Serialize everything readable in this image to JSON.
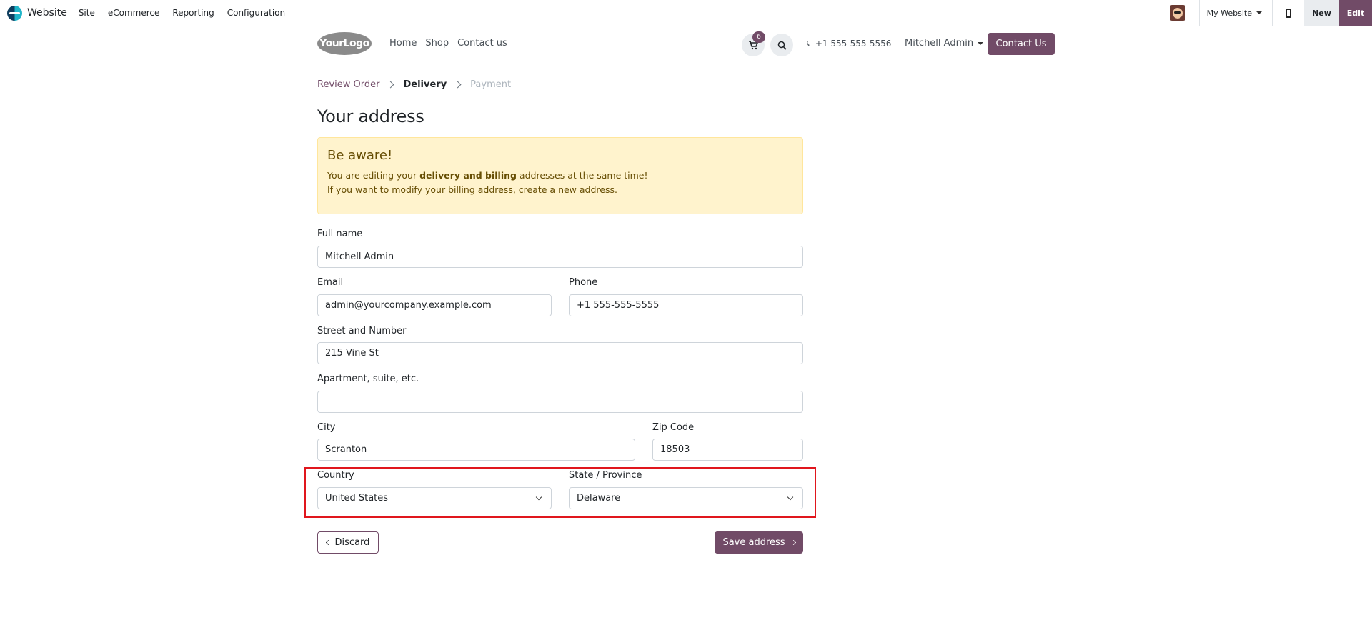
{
  "adminbar": {
    "app_name": "Website",
    "menu": [
      "Site",
      "eCommerce",
      "Reporting",
      "Configuration"
    ],
    "website_switcher": "My Website",
    "new_label": "New",
    "edit_label": "Edit"
  },
  "header": {
    "logo_text": "YourLogo",
    "nav": [
      "Home",
      "Shop",
      "Contact us"
    ],
    "cart_count": "6",
    "phone": "+1 555-555-5556",
    "user": "Mitchell Admin",
    "contact_button": "Contact Us"
  },
  "breadcrumb": {
    "step1": "Review Order",
    "step2": "Delivery",
    "step3": "Payment"
  },
  "page_title": "Your address",
  "alert": {
    "title": "Be aware!",
    "line1_pre": "You are editing your ",
    "line1_bold": "delivery and billing",
    "line1_post": " addresses at the same time!",
    "line2": "If you want to modify your billing address, create a new address."
  },
  "form": {
    "full_name": {
      "label": "Full name",
      "value": "Mitchell Admin"
    },
    "email": {
      "label": "Email",
      "value": "admin@yourcompany.example.com"
    },
    "phone": {
      "label": "Phone",
      "value": "+1 555-555-5555"
    },
    "street": {
      "label": "Street and Number",
      "value": "215 Vine St"
    },
    "street2": {
      "label": "Apartment, suite, etc.",
      "value": ""
    },
    "city": {
      "label": "City",
      "value": "Scranton"
    },
    "zip": {
      "label": "Zip Code",
      "value": "18503"
    },
    "country": {
      "label": "Country",
      "value": "United States"
    },
    "state": {
      "label": "State / Province",
      "value": "Delaware"
    }
  },
  "actions": {
    "discard": "Discard",
    "save": "Save address"
  }
}
